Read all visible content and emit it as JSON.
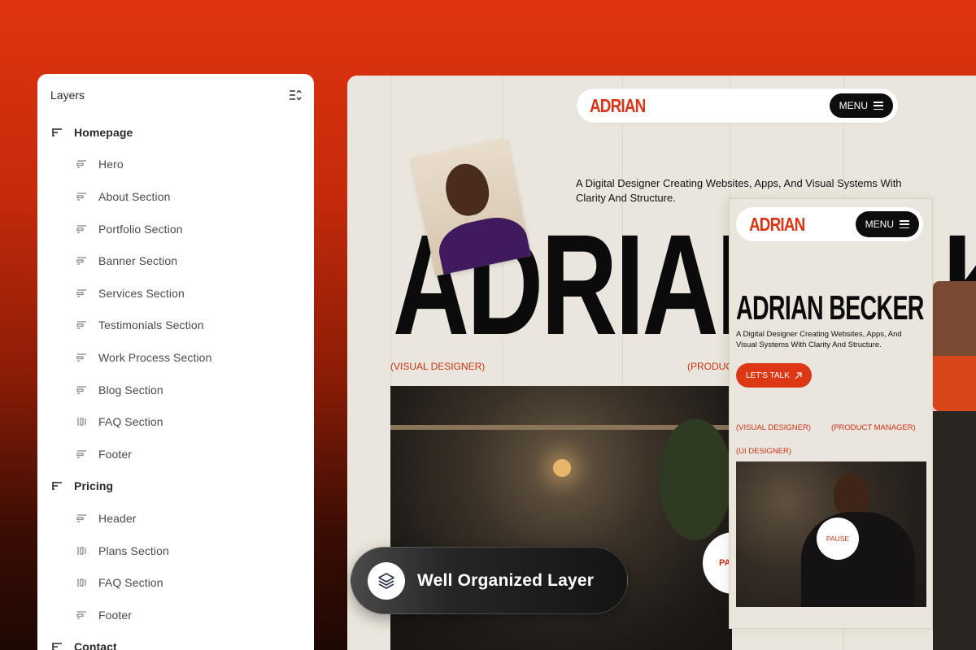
{
  "layers_panel": {
    "title": "Layers",
    "groups": [
      {
        "label": "Homepage",
        "children": [
          "Hero",
          "About Section",
          "Portfolio Section",
          "Banner Section",
          "Services Section",
          "Testimonials Section",
          "Work Process Section",
          "Blog Section",
          "FAQ Section",
          "Footer"
        ]
      },
      {
        "label": "Pricing",
        "children": [
          "Header",
          "Plans Section",
          "FAQ Section",
          "Footer"
        ]
      },
      {
        "label": "Contact",
        "children": []
      }
    ]
  },
  "desktop_preview": {
    "brand": "ADRIAN",
    "menu_label": "MENU",
    "tagline": "A Digital Designer Creating Websites, Apps, And Visual Systems With Clarity And Structure.",
    "big_name": "ADRIAN",
    "big_name_tail": "K",
    "role_left": "(VISUAL DESIGNER)",
    "role_right": "(PRODUC",
    "pause_label": "PA"
  },
  "mobile_preview": {
    "brand": "ADRIAN",
    "menu_label": "MENU",
    "title": "ADRIAN BECKER",
    "subtitle": "A Digital Designer Creating Websites, Apps, And Visual Systems With Clarity And Structure.",
    "cta_label": "LET'S TALK",
    "roles": [
      "(VISUAL DESIGNER)",
      "(PRODUCT MANAGER)",
      "(UI DESIGNER)"
    ],
    "pause_label": "PAUSE"
  },
  "badge": {
    "label": "Well Organized Layer",
    "icon": "layers-icon"
  },
  "colors": {
    "accent": "#d83516",
    "dark": "#0b0b0b",
    "canvas": "#ebe6dd"
  }
}
